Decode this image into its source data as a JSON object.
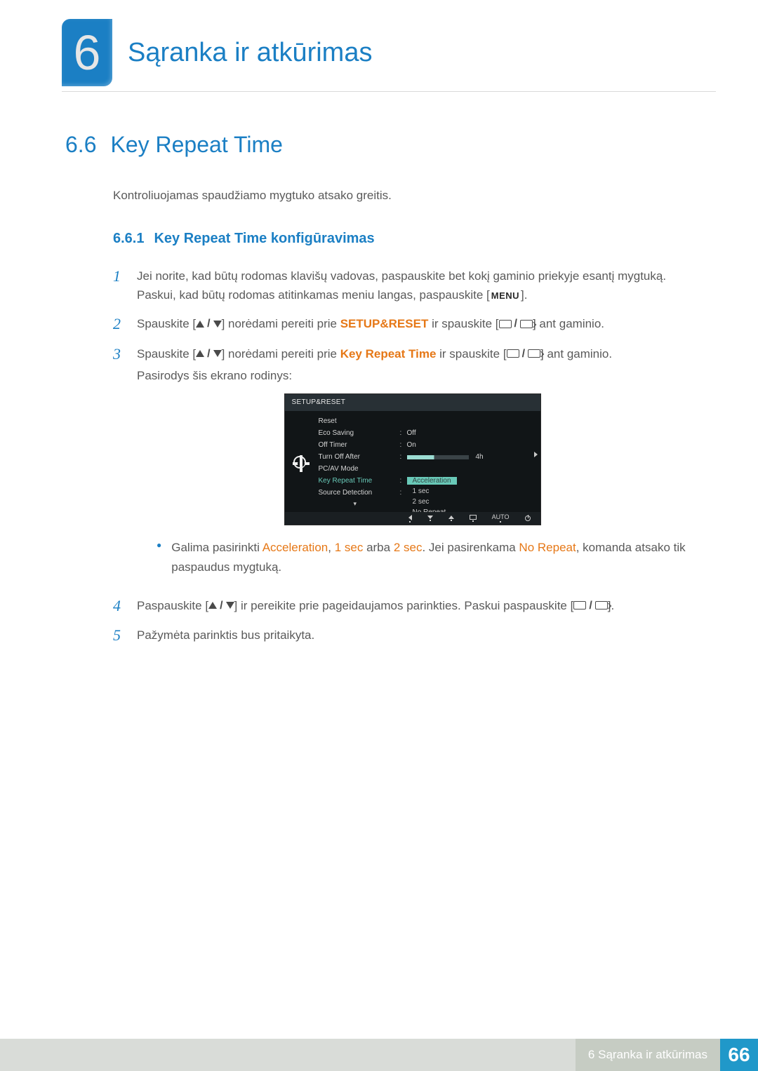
{
  "header": {
    "chapter_number": "6",
    "chapter_title": "Sąranka ir atkūrimas"
  },
  "section": {
    "num": "6.6",
    "title": "Key Repeat Time",
    "intro": "Kontroliuojamas spaudžiamo mygtuko atsako greitis."
  },
  "subsection": {
    "num": "6.6.1",
    "title": "Key Repeat Time konfigūravimas"
  },
  "steps": {
    "s1_a": "Jei norite, kad būtų rodomas klavišų vadovas, paspauskite bet kokį gaminio priekyje esantį mygtuką. Paskui, kad būtų rodomas atitinkamas meniu langas, paspauskite [",
    "s1_b": "].",
    "s2_a": "Spauskite [",
    "s2_b": "] norėdami pereiti prie ",
    "s2_hl": "SETUP&RESET",
    "s2_c": " ir spauskite [",
    "s2_d": "] ant gaminio.",
    "s3_a": "Spauskite [",
    "s3_b": "] norėdami pereiti prie ",
    "s3_hl": "Key Repeat Time",
    "s3_c": " ir spauskite [",
    "s3_d": "] ant gaminio.",
    "s3_caption": "Pasirodys šis ekrano rodinys:",
    "bullet_a": "Galima pasirinkti ",
    "bullet_h1": "Acceleration",
    "bullet_sep1": ", ",
    "bullet_h2": "1 sec",
    "bullet_sep2": " arba ",
    "bullet_h3": "2 sec",
    "bullet_b": ". Jei pasirenkama ",
    "bullet_h4": "No Repeat",
    "bullet_c": ", komanda atsako tik paspaudus mygtuką.",
    "s4_a": "Paspauskite [",
    "s4_b": "] ir pereikite prie pageidaujamos parinkties. Paskui paspauskite [",
    "s4_c": "].",
    "s5": "Pažymėta parinktis bus pritaikyta."
  },
  "osd": {
    "title": "SETUP&RESET",
    "rows": {
      "reset": "Reset",
      "eco": "Eco Saving",
      "eco_val": "Off",
      "offtimer": "Off Timer",
      "offtimer_val": "On",
      "turnoff": "Turn Off After",
      "turnoff_val": "4h",
      "pcav": "PC/AV Mode",
      "krt": "Key Repeat Time",
      "src": "Source Detection"
    },
    "dropdown": {
      "opt1": "Acceleration",
      "opt2": "1 sec",
      "opt3": "2 sec",
      "opt4": "No Repeat"
    },
    "bottombar_auto": "AUTO"
  },
  "icons": {
    "menu_label": "MENU"
  },
  "footer": {
    "text": "6 Sąranka ir atkūrimas",
    "page": "66"
  }
}
